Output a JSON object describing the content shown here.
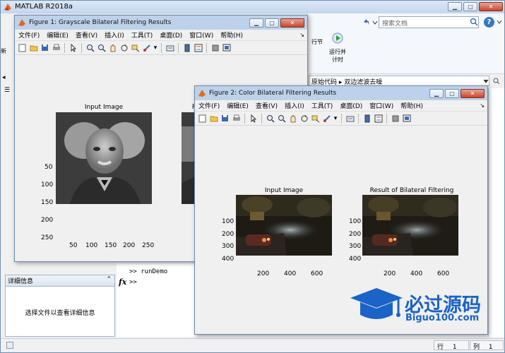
{
  "app": {
    "title": "MATLAB R2018a",
    "search_placeholder": "搜索文档",
    "ribbon": {
      "btn_a_label": "行节",
      "btn_b_label_1": "运行并",
      "btn_b_label_2": "计时"
    },
    "path": [
      "原始代码",
      "双边滤波去噪"
    ],
    "details_panel": {
      "title": "详细信息",
      "message": "选择文件以查看详细信息"
    },
    "command_window": {
      "line1": ">> runDemo",
      "prompt_symbol": "fx",
      "prompt": ">>"
    },
    "status": {
      "row_label": "行",
      "row_value": "1",
      "col_label": "列",
      "col_value": "1"
    }
  },
  "figure1": {
    "title": "Figure 1: Grayscale Bilateral Filtering Results",
    "menu": [
      "文件(F)",
      "编辑(E)",
      "查看(V)",
      "插入(I)",
      "工具(T)",
      "桌面(D)",
      "窗口(W)",
      "帮助(H)"
    ],
    "axes_title": "Input Image",
    "second_axes_title_partial": "R",
    "y_ticks": [
      "50",
      "100",
      "150",
      "200",
      "250"
    ],
    "x_ticks": [
      "50",
      "100",
      "150",
      "200",
      "250"
    ]
  },
  "figure2": {
    "title": "Figure 2: Color Bilateral Filtering Results",
    "menu": [
      "文件(F)",
      "编辑(E)",
      "查看(V)",
      "插入(I)",
      "工具(T)",
      "桌面(D)",
      "窗口(W)",
      "帮助(H)"
    ],
    "left_axes_title": "Input Image",
    "right_axes_title": "Result of Bilateral Filtering",
    "y_ticks": [
      "100",
      "200",
      "300",
      "400"
    ],
    "x_ticks": [
      "200",
      "400",
      "600"
    ]
  },
  "watermark": {
    "title": "必过源码",
    "url": "Biguo100.com"
  },
  "colors": {
    "titlebar": "#c4d7ee",
    "figure_bg": "#f0f0f0",
    "accent": "#1b63c6"
  }
}
